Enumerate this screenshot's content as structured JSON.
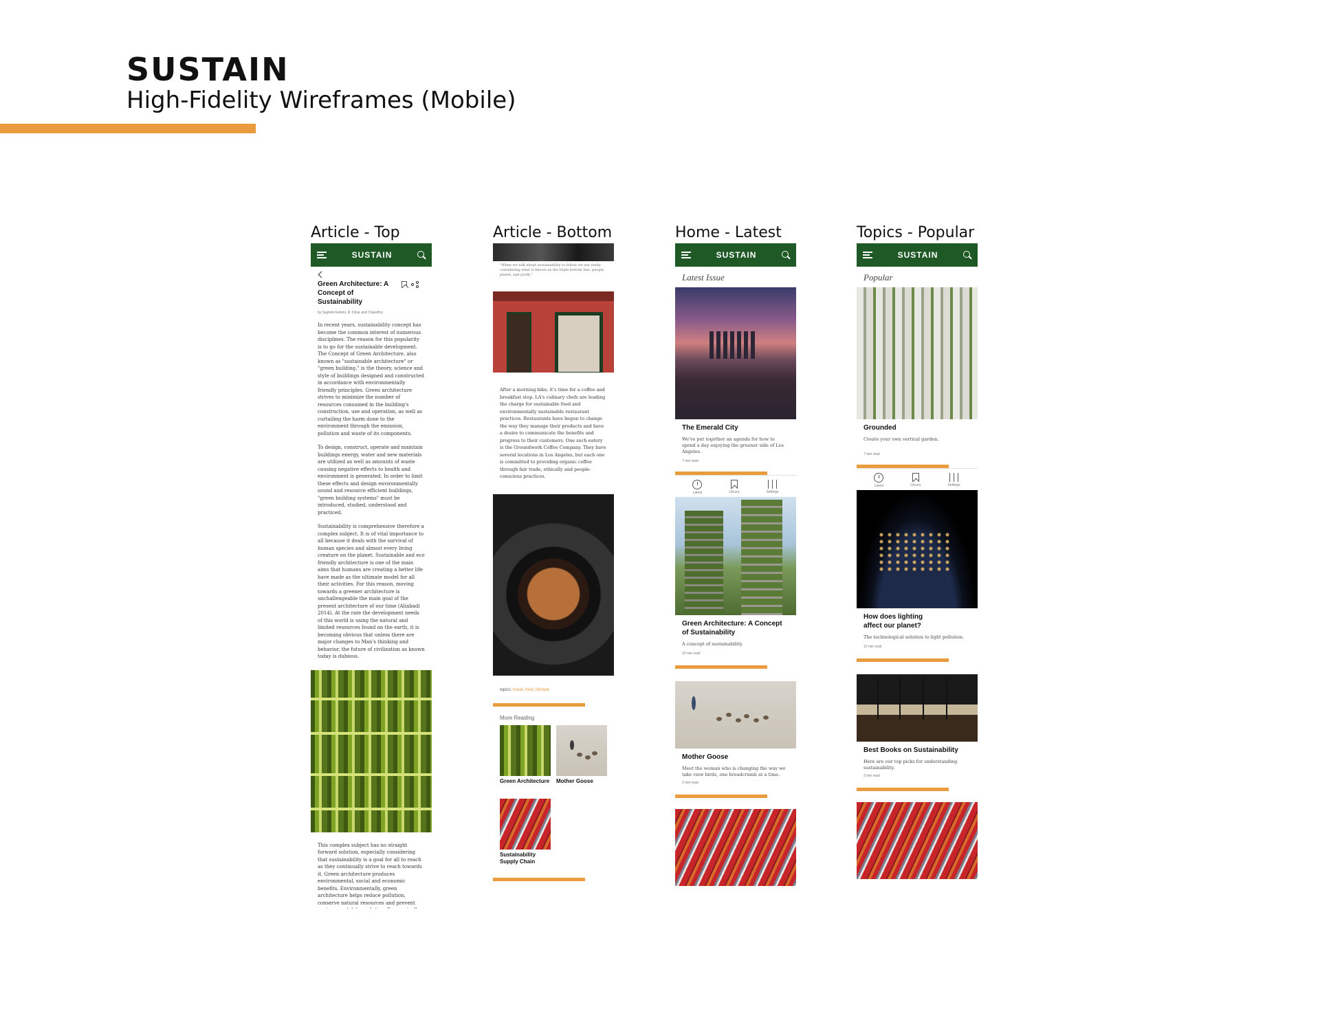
{
  "header": {
    "brand": "SUSTAIN",
    "subtitle": "High-Fidelity Wireframes (Mobile)"
  },
  "colors": {
    "accent": "#e99b3e",
    "topbar": "#1f5a26"
  },
  "app": {
    "logo": "SUSTAIN"
  },
  "screens": {
    "article_top": {
      "label": "Article - Top",
      "title": "Green Architecture: A Concept of Sustainability",
      "byline": "by Sagheb Rahimi, R. Dinar and Chaudhry",
      "p1": "In recent years, sustainability concept has become the common interest of numerous disciplines. The reason for this popularity is to go for the sustainable development. The Concept of Green Architecture, also known as \"sustainable architecture\" or \"green building,\" is the theory, science and style of buildings designed and constructed in accordance with environmentally friendly principles. Green architecture strives to minimize the number of resources consumed in the building's construction, use and operation, as well as curtailing the harm done to the environment through the emission, pollution and waste of its components.",
      "p2": "To design, construct, operate and maintain buildings energy, water and new materials are utilized as well as amounts of waste causing negative effects to health and environment is generated. In order to limit these effects and design environmentally sound and resource efficient buildings, \"green building systems\" must be introduced, studied, understood and practiced.",
      "p3": "Sustainability is comprehensive therefore a complex subject. It is of vital importance to all because it deals with the survival of human species and almost every living creature on the planet. Sustainable and eco friendly architecture is one of the main aims that humans are creating a better life have made as the ultimate model for all their activities. For this reason, moving towards a greener architecture is unchallengeable the main goal of the present architecture of our time (Aliabadi 2014). At the rate the development needs of this world is using the natural and limited resources found on the earth, it is becoming obvious that unless there are major changes to Man's thinking and behavior, the future of civilization as known today is dubious.",
      "p4": "This complex subject has no straight forward solution, especially considering that sustainability is a goal for all to reach as they continually strive to reach towards it. Green architecture produces environmental, social and economic benefits. Environmentally, green architecture helps reduce pollution, conserve natural resources and prevent environmental degradation. Economically, it reduces the amount of money that the building's operators have to spend on water and energy and improves the productivity of those using the facility (Thomas, 2009) and, socially, green buildings are meant to be beautiful and cause only"
    },
    "article_bottom": {
      "label": "Article - Bottom",
      "quote": "\"When we talk about sustainability to follow we are really considering what is known as the triple bottom line: people, planet, and profit.\"",
      "body": "After a morning hike, it's time for a coffee and breakfast stop. LA's culinary chefs are leading the charge for sustainable food and environmentally sustainable restaurant practices. Restaurants have begun to change the way they manage their products and have a desire to communicate the benefits and progress to their customers. One such eatery is the Groundwork Coffee Company. They have several locations in Los Angeles, but each one is committed to providing organic coffee through fair trade, ethically and people-conscious practices.",
      "topics_prefix": "topics:",
      "topics": "travel, food, lifestyle",
      "more_reading": "More Reading",
      "reading": [
        {
          "title": "Green Architecture"
        },
        {
          "title": "Mother Goose"
        },
        {
          "title": "Sustainability Supply Chain"
        }
      ]
    },
    "home_latest": {
      "label": "Home - Latest",
      "section": "Latest Issue",
      "cards": [
        {
          "title": "The Emerald City",
          "desc": "We've put together an agenda for how to spend a day enjoying the greener side of Los Angeles.",
          "meta": "7 min read"
        },
        {
          "title": "Green Architecture: A Concept of Sustainability",
          "desc": "A concept of sustainability.",
          "meta": "10 min read"
        },
        {
          "title": "Mother Goose",
          "desc": "Meet the woman who is changing the way we take view birds, one breadcrumb at a time.",
          "meta": "2 min read"
        }
      ]
    },
    "topics_popular": {
      "label": "Topics - Popular",
      "section": "Popular",
      "cards": [
        {
          "title": "Grounded",
          "desc": "Create your own vertical garden.",
          "meta": "7 min read"
        },
        {
          "title": "How does lighting affect our planet?",
          "desc": "The technological solution to light pollution.",
          "meta": "10 min read"
        },
        {
          "title": "Best Books on Sustainability",
          "desc": "Here are our top picks for understanding sustainability.",
          "meta": "3 min read"
        }
      ]
    }
  },
  "nav_tabs": [
    "Latest",
    "Library",
    "Settings"
  ]
}
